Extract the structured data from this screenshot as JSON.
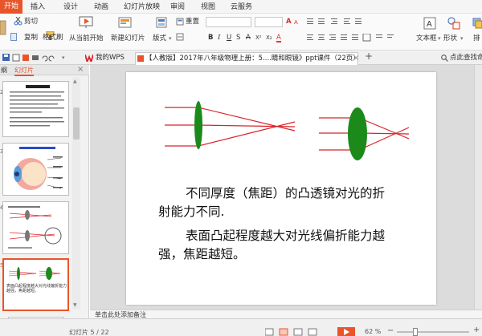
{
  "menu": {
    "tabs": [
      "开始",
      "插入",
      "设计",
      "动画",
      "幻灯片放映",
      "审阅",
      "视图",
      "云服务"
    ]
  },
  "ribbon": {
    "cut": "剪切",
    "copy": "复制",
    "format_painter": "格式刷",
    "from_current": "从当前开始",
    "new_slide": "新建幻灯片",
    "layout": "版式",
    "reset": "重置",
    "textbox": "文本框",
    "shapes": "形状",
    "arrange": "排"
  },
  "tabbar": {
    "my_wps": "我的WPS",
    "doc_title": "【人教版】2017年八年级物理上册：5....睛和眼镜》ppt课件（22页）.ppt",
    "search": "点此查找命令"
  },
  "panel": {
    "tab_outline": "纲",
    "tab_slides": "幻灯片",
    "thumb_numbers": [
      "2",
      "3",
      "4",
      "5"
    ],
    "thumb5_text": "表面凸起程度越大对光线偏折能力越强，焦距越短。"
  },
  "slide": {
    "para1_line1": "不同厚度（焦距）的凸透镜对光的折",
    "para1_line2": "射能力不同.",
    "para2_line1": "表面凸起程度越大对光线偏折能力越",
    "para2_line2": "强，焦距越短。"
  },
  "notes": {
    "placeholder": "单击此处添加备注"
  },
  "status": {
    "slide_counter": "幻灯片 5 / 22",
    "zoom": "62 %"
  },
  "colors": {
    "accent": "#e8552b",
    "lens": "#1b8a1b",
    "ray": "#d8242a"
  }
}
